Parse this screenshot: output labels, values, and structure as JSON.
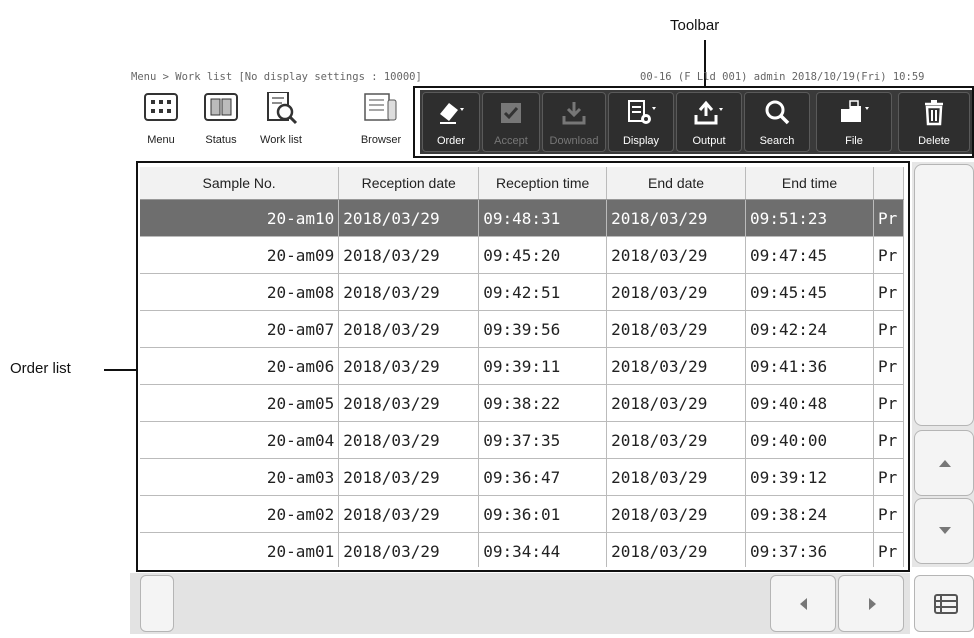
{
  "annotations": {
    "toolbar": "Toolbar",
    "order_list": "Order list"
  },
  "status_bar": {
    "left": "Menu > Work list [No display settings : 10000]",
    "right": "00-16 (F Lld 001) admin 2018/10/19(Fri) 10:59"
  },
  "nav": [
    {
      "label": "Menu",
      "icon": "menu-grid-icon"
    },
    {
      "label": "Status",
      "icon": "status-icon"
    },
    {
      "label": "Work list",
      "icon": "work-list-icon"
    },
    {
      "label": "Browser",
      "icon": "browser-icon"
    }
  ],
  "toolbar": [
    {
      "label": "Order",
      "icon": "eraser-icon",
      "enabled": true
    },
    {
      "label": "Accept",
      "icon": "checkbox-icon",
      "enabled": false
    },
    {
      "label": "Download",
      "icon": "download-icon",
      "enabled": false
    },
    {
      "label": "Display",
      "icon": "display-settings-icon",
      "enabled": true
    },
    {
      "label": "Output",
      "icon": "upload-icon",
      "enabled": true
    },
    {
      "label": "Search",
      "icon": "search-icon",
      "enabled": true
    },
    {
      "label": "File",
      "icon": "file-icon",
      "enabled": true
    },
    {
      "label": "Delete",
      "icon": "trash-icon",
      "enabled": true
    }
  ],
  "table": {
    "columns": [
      "Sample No.",
      "Reception date",
      "Reception time",
      "End date",
      "End time",
      ""
    ],
    "rows": [
      [
        "20-am10",
        "2018/03/29",
        "09:48:31",
        "2018/03/29",
        "09:51:23",
        "Pr"
      ],
      [
        "20-am09",
        "2018/03/29",
        "09:45:20",
        "2018/03/29",
        "09:47:45",
        "Pr"
      ],
      [
        "20-am08",
        "2018/03/29",
        "09:42:51",
        "2018/03/29",
        "09:45:45",
        "Pr"
      ],
      [
        "20-am07",
        "2018/03/29",
        "09:39:56",
        "2018/03/29",
        "09:42:24",
        "Pr"
      ],
      [
        "20-am06",
        "2018/03/29",
        "09:39:11",
        "2018/03/29",
        "09:41:36",
        "Pr"
      ],
      [
        "20-am05",
        "2018/03/29",
        "09:38:22",
        "2018/03/29",
        "09:40:48",
        "Pr"
      ],
      [
        "20-am04",
        "2018/03/29",
        "09:37:35",
        "2018/03/29",
        "09:40:00",
        "Pr"
      ],
      [
        "20-am03",
        "2018/03/29",
        "09:36:47",
        "2018/03/29",
        "09:39:12",
        "Pr"
      ],
      [
        "20-am02",
        "2018/03/29",
        "09:36:01",
        "2018/03/29",
        "09:38:24",
        "Pr"
      ],
      [
        "20-am01",
        "2018/03/29",
        "09:34:44",
        "2018/03/29",
        "09:37:36",
        "Pr"
      ]
    ],
    "selected_row": 0
  },
  "scroll": {
    "up_icon": "triangle-up-icon",
    "down_icon": "triangle-down-icon",
    "left_icon": "triangle-left-icon",
    "right_icon": "triangle-right-icon",
    "grid_icon": "table-layout-icon"
  }
}
